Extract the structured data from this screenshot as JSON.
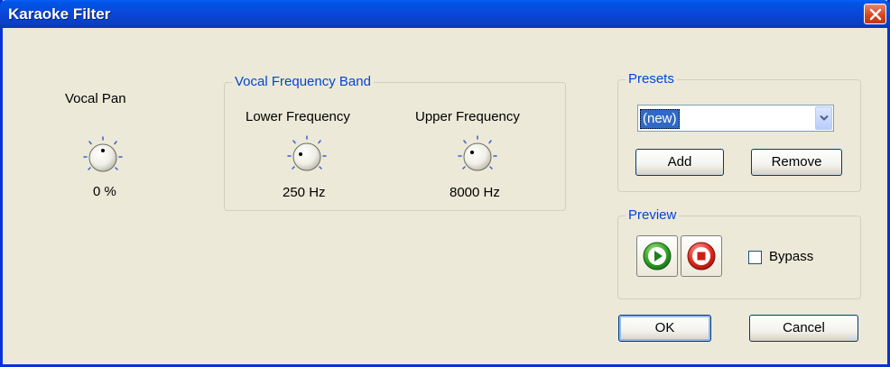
{
  "window": {
    "title": "Karaoke Filter",
    "close_icon": "close-x-icon"
  },
  "vocal_pan": {
    "label": "Vocal Pan",
    "value": "0 %"
  },
  "vocal_band": {
    "legend": "Vocal Frequency Band",
    "lower": {
      "label": "Lower Frequency",
      "value": "250 Hz"
    },
    "upper": {
      "label": "Upper Frequency",
      "value": "8000 Hz"
    }
  },
  "presets": {
    "legend": "Presets",
    "selected": "(new)",
    "add_label": "Add",
    "remove_label": "Remove"
  },
  "preview": {
    "legend": "Preview",
    "play_icon": "play-icon",
    "stop_icon": "stop-icon",
    "bypass_label": "Bypass",
    "bypass_checked": false
  },
  "footer": {
    "ok_label": "OK",
    "cancel_label": "Cancel"
  },
  "colors": {
    "titlebar": "#0a46d8",
    "groupbox_legend": "#0046d5",
    "dialog_background": "#ece9d8",
    "selection": "#316ac5"
  }
}
